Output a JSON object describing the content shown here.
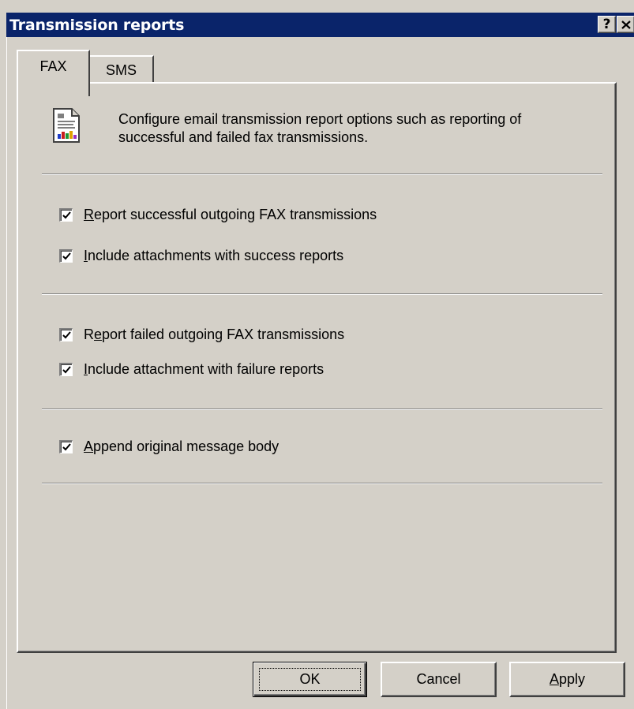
{
  "window": {
    "title": "Transmission reports",
    "help_button": "?",
    "close_button": "✕"
  },
  "tabs": [
    {
      "label": "FAX",
      "selected": true
    },
    {
      "label": "SMS",
      "selected": false
    }
  ],
  "panel": {
    "icon": "report-document-icon",
    "description_line1": "Configure email transmission report options such as reporting of",
    "description_line2": "successful and failed fax transmissions.",
    "options": [
      {
        "mnemonic": "R",
        "rest": "eport successful outgoing FAX transmissions",
        "checked": true
      },
      {
        "mnemonic": "I",
        "rest": "nclude attachments with success reports",
        "checked": true
      },
      {
        "before": "R",
        "mnemonic": "e",
        "rest": "port failed outgoing FAX transmissions",
        "checked": true
      },
      {
        "mnemonic": "I",
        "rest": "nclude attachment with failure reports",
        "checked": true
      },
      {
        "mnemonic": "A",
        "rest": "ppend original message body",
        "checked": true
      }
    ]
  },
  "buttons": {
    "ok": "OK",
    "cancel": "Cancel",
    "apply_mnemonic": "A",
    "apply_rest": "pply"
  },
  "colors": {
    "titlebar": "#0a246a",
    "face": "#d4d0c8"
  }
}
